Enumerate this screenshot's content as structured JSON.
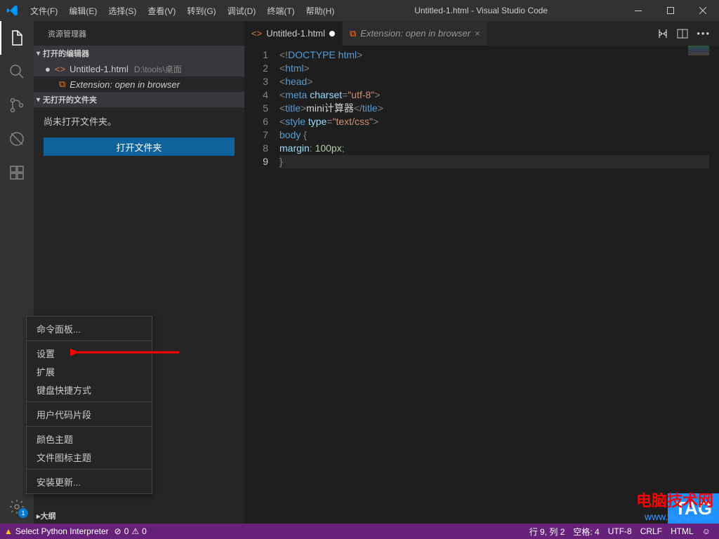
{
  "titlebar": {
    "title": "Untitled-1.html - Visual Studio Code",
    "menus": [
      "文件(F)",
      "编辑(E)",
      "选择(S)",
      "查看(V)",
      "转到(G)",
      "调试(D)",
      "终端(T)",
      "帮助(H)"
    ]
  },
  "sidebar": {
    "title": "资源管理器",
    "open_editors_label": "打开的编辑器",
    "editors": [
      {
        "name": "Untitled-1.html",
        "path": "D:\\tools\\桌面",
        "italic": false,
        "dirty": true
      },
      {
        "name": "Extension: open in browser",
        "path": "",
        "italic": true,
        "dirty": false
      }
    ],
    "no_folder_label": "无打开的文件夹",
    "no_folder_msg": "尚未打开文件夹。",
    "open_folder_btn": "打开文件夹",
    "outline_label": "大纲"
  },
  "settings_badge": "1",
  "tabs": [
    {
      "name": "Untitled-1.html",
      "italic": false,
      "dirty": true,
      "active": true
    },
    {
      "name": "Extension: open in browser",
      "italic": true,
      "dirty": false,
      "active": false
    }
  ],
  "code": {
    "lines": [
      [
        {
          "t": "punct",
          "v": "<!"
        },
        {
          "t": "doctype",
          "v": "DOCTYPE"
        },
        {
          "t": "text",
          "v": " "
        },
        {
          "t": "tag",
          "v": "html"
        },
        {
          "t": "punct",
          "v": ">"
        }
      ],
      [
        {
          "t": "punct",
          "v": "<"
        },
        {
          "t": "tag",
          "v": "html"
        },
        {
          "t": "punct",
          "v": ">"
        }
      ],
      [
        {
          "t": "punct",
          "v": "<"
        },
        {
          "t": "tag",
          "v": "head"
        },
        {
          "t": "punct",
          "v": ">"
        }
      ],
      [
        {
          "t": "punct",
          "v": "<"
        },
        {
          "t": "tag",
          "v": "meta"
        },
        {
          "t": "text",
          "v": " "
        },
        {
          "t": "attr",
          "v": "charset"
        },
        {
          "t": "punct",
          "v": "="
        },
        {
          "t": "str",
          "v": "\"utf-8\""
        },
        {
          "t": "punct",
          "v": ">"
        }
      ],
      [
        {
          "t": "punct",
          "v": "<"
        },
        {
          "t": "tag",
          "v": "title"
        },
        {
          "t": "punct",
          "v": ">"
        },
        {
          "t": "text",
          "v": "mini计算器"
        },
        {
          "t": "punct",
          "v": "</"
        },
        {
          "t": "tag",
          "v": "title"
        },
        {
          "t": "punct",
          "v": ">"
        }
      ],
      [
        {
          "t": "punct",
          "v": "<"
        },
        {
          "t": "tag",
          "v": "style"
        },
        {
          "t": "text",
          "v": " "
        },
        {
          "t": "attr",
          "v": "type"
        },
        {
          "t": "punct",
          "v": "="
        },
        {
          "t": "str",
          "v": "\"text/css\""
        },
        {
          "t": "punct",
          "v": ">"
        }
      ],
      [
        {
          "t": "tag",
          "v": "body"
        },
        {
          "t": "text",
          "v": " "
        },
        {
          "t": "punct",
          "v": "{"
        }
      ],
      [
        {
          "t": "attr",
          "v": "margin"
        },
        {
          "t": "punct",
          "v": ": "
        },
        {
          "t": "num",
          "v": "100px"
        },
        {
          "t": "punct",
          "v": ";"
        }
      ],
      [
        {
          "t": "punct",
          "v": "}"
        }
      ]
    ],
    "current_line": 9
  },
  "context_menu": {
    "items": [
      {
        "label": "命令面板...",
        "sep_after": true
      },
      {
        "label": "设置",
        "sep_after": false
      },
      {
        "label": "扩展",
        "sep_after": false
      },
      {
        "label": "键盘快捷方式",
        "sep_after": true
      },
      {
        "label": "用户代码片段",
        "sep_after": true
      },
      {
        "label": "颜色主题",
        "sep_after": false
      },
      {
        "label": "文件图标主题",
        "sep_after": true
      },
      {
        "label": "安装更新...",
        "sep_after": false
      }
    ]
  },
  "status": {
    "interpreter": "Select Python Interpreter",
    "errors": "0",
    "warnings": "0",
    "cursor": "行 9, 列 2",
    "spaces": "空格: 4",
    "encoding": "UTF-8",
    "eol": "CRLF",
    "lang": "HTML",
    "feedback": "☺"
  },
  "watermark": {
    "title": "电脑技术网",
    "url": "www.tagxp.com",
    "tag": "TAG"
  }
}
